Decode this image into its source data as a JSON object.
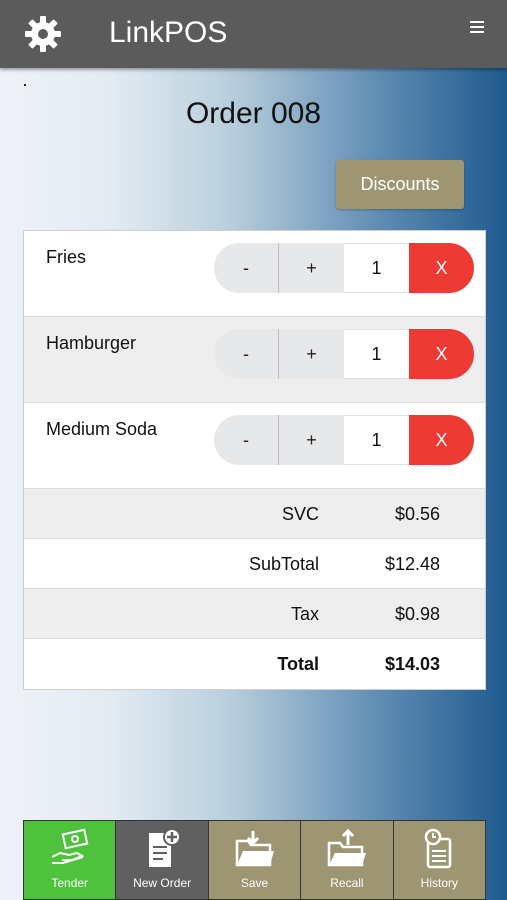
{
  "header": {
    "app_title": "LinkPOS",
    "settings_icon": "gear-icon",
    "menu_icon": "hamburger-menu-icon"
  },
  "order": {
    "title": "Order 008",
    "discounts_label": "Discounts"
  },
  "items": [
    {
      "name": "Fries",
      "qty": "1",
      "minus": "-",
      "plus": "+",
      "remove": "X"
    },
    {
      "name": "Hamburger",
      "qty": "1",
      "minus": "-",
      "plus": "+",
      "remove": "X"
    },
    {
      "name": "Medium Soda",
      "qty": "1",
      "minus": "-",
      "plus": "+",
      "remove": "X"
    }
  ],
  "totals": [
    {
      "label": "SVC",
      "value": "$0.56"
    },
    {
      "label": "SubTotal",
      "value": "$12.48"
    },
    {
      "label": "Tax",
      "value": "$0.98"
    },
    {
      "label": "Total",
      "value": "$14.03"
    }
  ],
  "tabs": [
    {
      "label": "Tender",
      "icon": "tender-icon"
    },
    {
      "label": "New Order",
      "icon": "new-order-icon"
    },
    {
      "label": "Save",
      "icon": "save-folder-icon"
    },
    {
      "label": "Recall",
      "icon": "recall-folder-icon"
    },
    {
      "label": "History",
      "icon": "history-icon"
    }
  ],
  "colors": {
    "topbar": "#5b5b5b",
    "discounts": "#9e9673",
    "remove": "#ee3a35",
    "tender": "#4fc23d",
    "new_order": "#606060",
    "tab_tan": "#9e9673"
  }
}
